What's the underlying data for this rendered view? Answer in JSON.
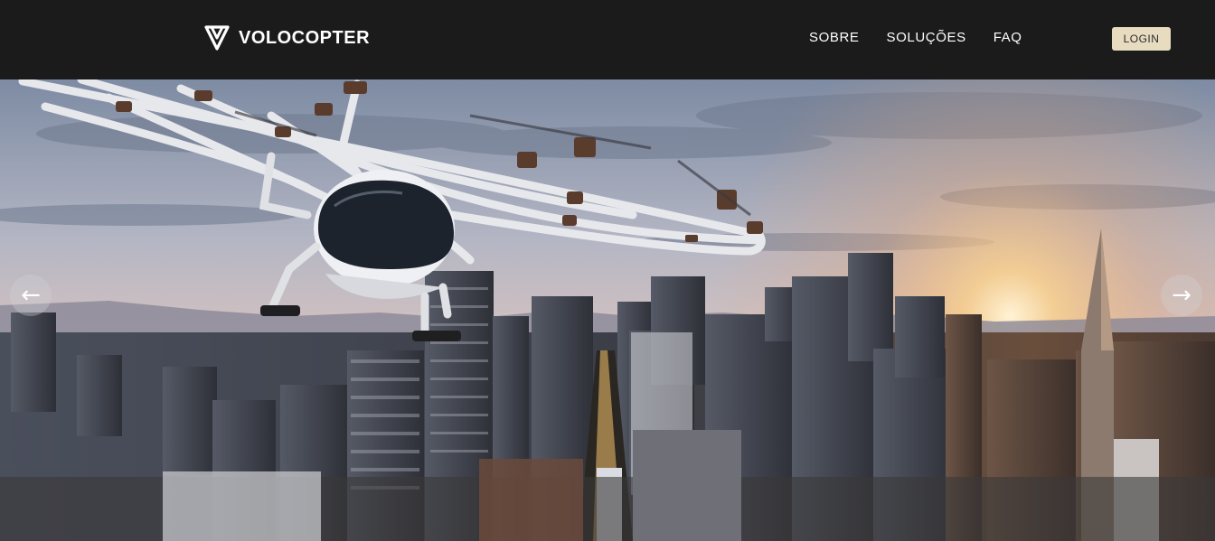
{
  "brand": {
    "name": "VOLOCOPTER",
    "logo_icon": "volocopter-logo-icon"
  },
  "nav": {
    "items": [
      {
        "label": "SOBRE"
      },
      {
        "label": "SOLUÇÕES"
      },
      {
        "label": "FAQ"
      }
    ]
  },
  "login": {
    "label": "LOGIN"
  },
  "hero": {
    "image_description_icon": "hero-image",
    "prev_arrow": "←",
    "next_arrow": "→"
  },
  "colors": {
    "header_bg": "#1b1b1b",
    "login_bg": "#e8dcc0",
    "sky_top": "#8f9db2",
    "sunset": "#f6c27a"
  }
}
